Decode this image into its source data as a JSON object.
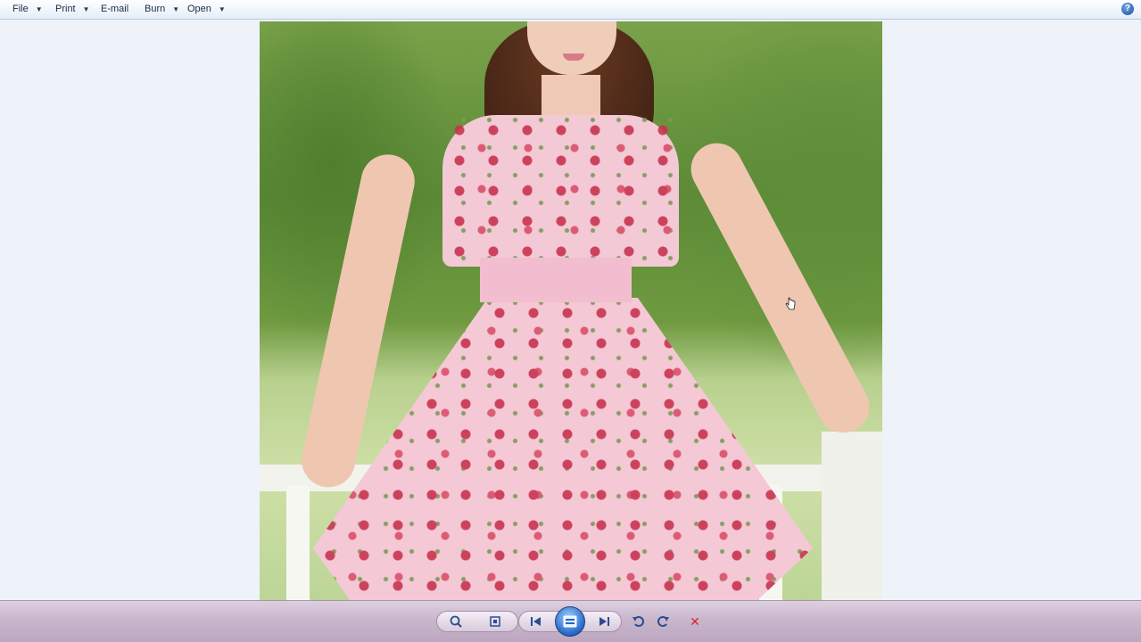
{
  "menubar": {
    "items": [
      {
        "label": "File",
        "has_dropdown": true
      },
      {
        "label": "Print",
        "has_dropdown": true
      },
      {
        "label": "E-mail",
        "has_dropdown": false
      },
      {
        "label": "Burn",
        "has_dropdown": true
      },
      {
        "label": "Open",
        "has_dropdown": true
      }
    ],
    "help_icon": "help-icon",
    "help_label": "?"
  },
  "viewer": {
    "image_subject": "photo"
  },
  "toolbar": {
    "buttons": [
      {
        "name": "zoom-icon",
        "glyph": "⌕"
      },
      {
        "name": "actual-size-icon",
        "glyph": "⊡"
      },
      {
        "name": "previous-icon",
        "glyph": "⏮"
      },
      {
        "name": "slideshow-icon",
        "glyph": "▭"
      },
      {
        "name": "next-icon",
        "glyph": "⏭"
      },
      {
        "name": "rotate-counterclockwise-icon",
        "glyph": "↺"
      },
      {
        "name": "rotate-clockwise-icon",
        "glyph": "↻"
      },
      {
        "name": "delete-icon",
        "glyph": "✕"
      }
    ]
  },
  "colors": {
    "menubar_bg": "#eef3fa",
    "toolbar_bg": "#c9b6cd",
    "accent": "#2366c7",
    "delete": "#d42a2a"
  }
}
